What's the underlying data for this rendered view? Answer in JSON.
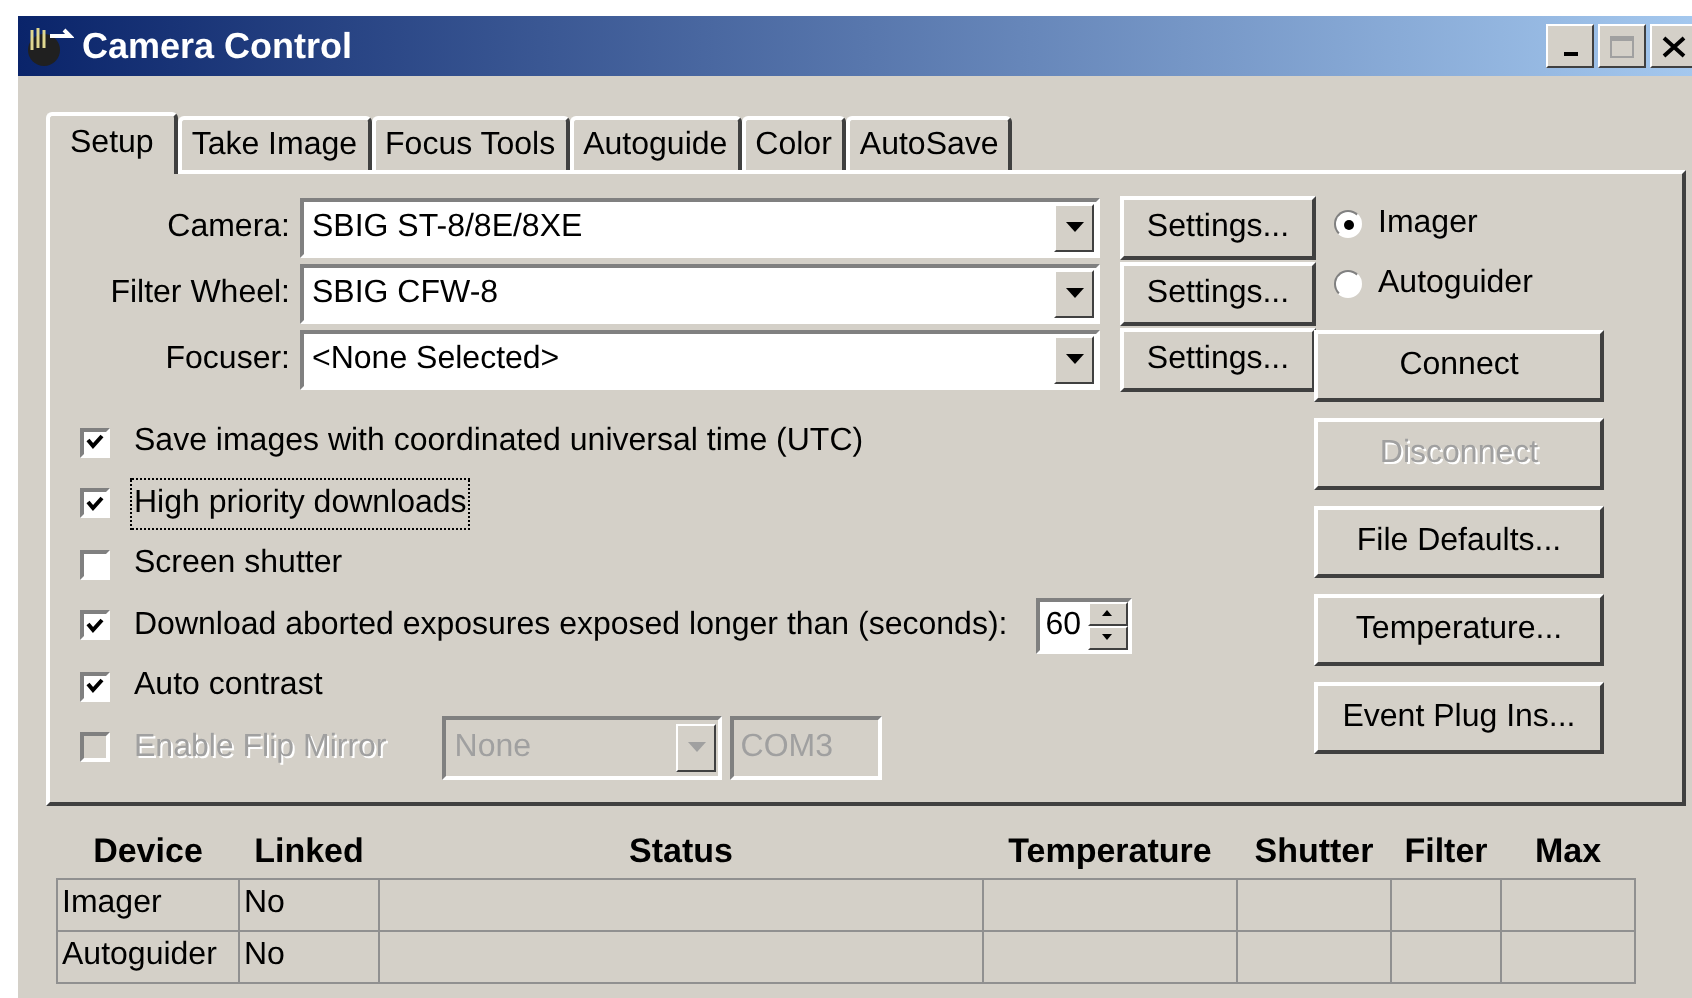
{
  "window": {
    "title": "Camera Control"
  },
  "tabs": [
    {
      "label": "Setup",
      "selected": true
    },
    {
      "label": "Take Image",
      "selected": false
    },
    {
      "label": "Focus Tools",
      "selected": false
    },
    {
      "label": "Autoguide",
      "selected": false
    },
    {
      "label": "Color",
      "selected": false
    },
    {
      "label": "AutoSave",
      "selected": false
    }
  ],
  "devices": [
    {
      "label": "Camera:",
      "value": "SBIG ST-8/8E/8XE",
      "button": "Settings..."
    },
    {
      "label": "Filter Wheel:",
      "value": "SBIG CFW-8",
      "button": "Settings..."
    },
    {
      "label": "Focuser:",
      "value": "<None Selected>",
      "button": "Settings..."
    }
  ],
  "device_mode": [
    {
      "label": "Imager",
      "selected": true
    },
    {
      "label": "Autoguider",
      "selected": false
    }
  ],
  "actions": [
    {
      "label": "Connect",
      "disabled": false
    },
    {
      "label": "Disconnect",
      "disabled": true
    },
    {
      "label": "File Defaults...",
      "disabled": false
    },
    {
      "label": "Temperature...",
      "disabled": false
    },
    {
      "label": "Event Plug Ins...",
      "disabled": false
    }
  ],
  "options": [
    {
      "kind": "check",
      "label": "Save images with coordinated universal time (UTC)",
      "checked": true,
      "disabled": false,
      "focused": false
    },
    {
      "kind": "check",
      "label": "High priority downloads",
      "checked": true,
      "disabled": false,
      "focused": true
    },
    {
      "kind": "check",
      "label": "Screen shutter",
      "checked": false,
      "disabled": false,
      "focused": false
    },
    {
      "kind": "spin",
      "label": "Download aborted exposures exposed longer than (seconds):",
      "checked": true,
      "disabled": false,
      "focused": false,
      "value": "60"
    },
    {
      "kind": "check",
      "label": "Auto contrast",
      "checked": true,
      "disabled": false,
      "focused": false
    },
    {
      "kind": "port",
      "label": "Enable Flip Mirror",
      "checked": false,
      "disabled": true,
      "focused": false,
      "select": "None",
      "port": "COM3"
    }
  ],
  "status_table": {
    "columns": [
      "Device",
      "Linked",
      "Status",
      "Temperature",
      "Shutter",
      "Filter",
      "Max"
    ],
    "rows": [
      {
        "cells": [
          "Imager",
          "No"
        ]
      },
      {
        "cells": [
          "Autoguider",
          "No"
        ]
      }
    ]
  }
}
